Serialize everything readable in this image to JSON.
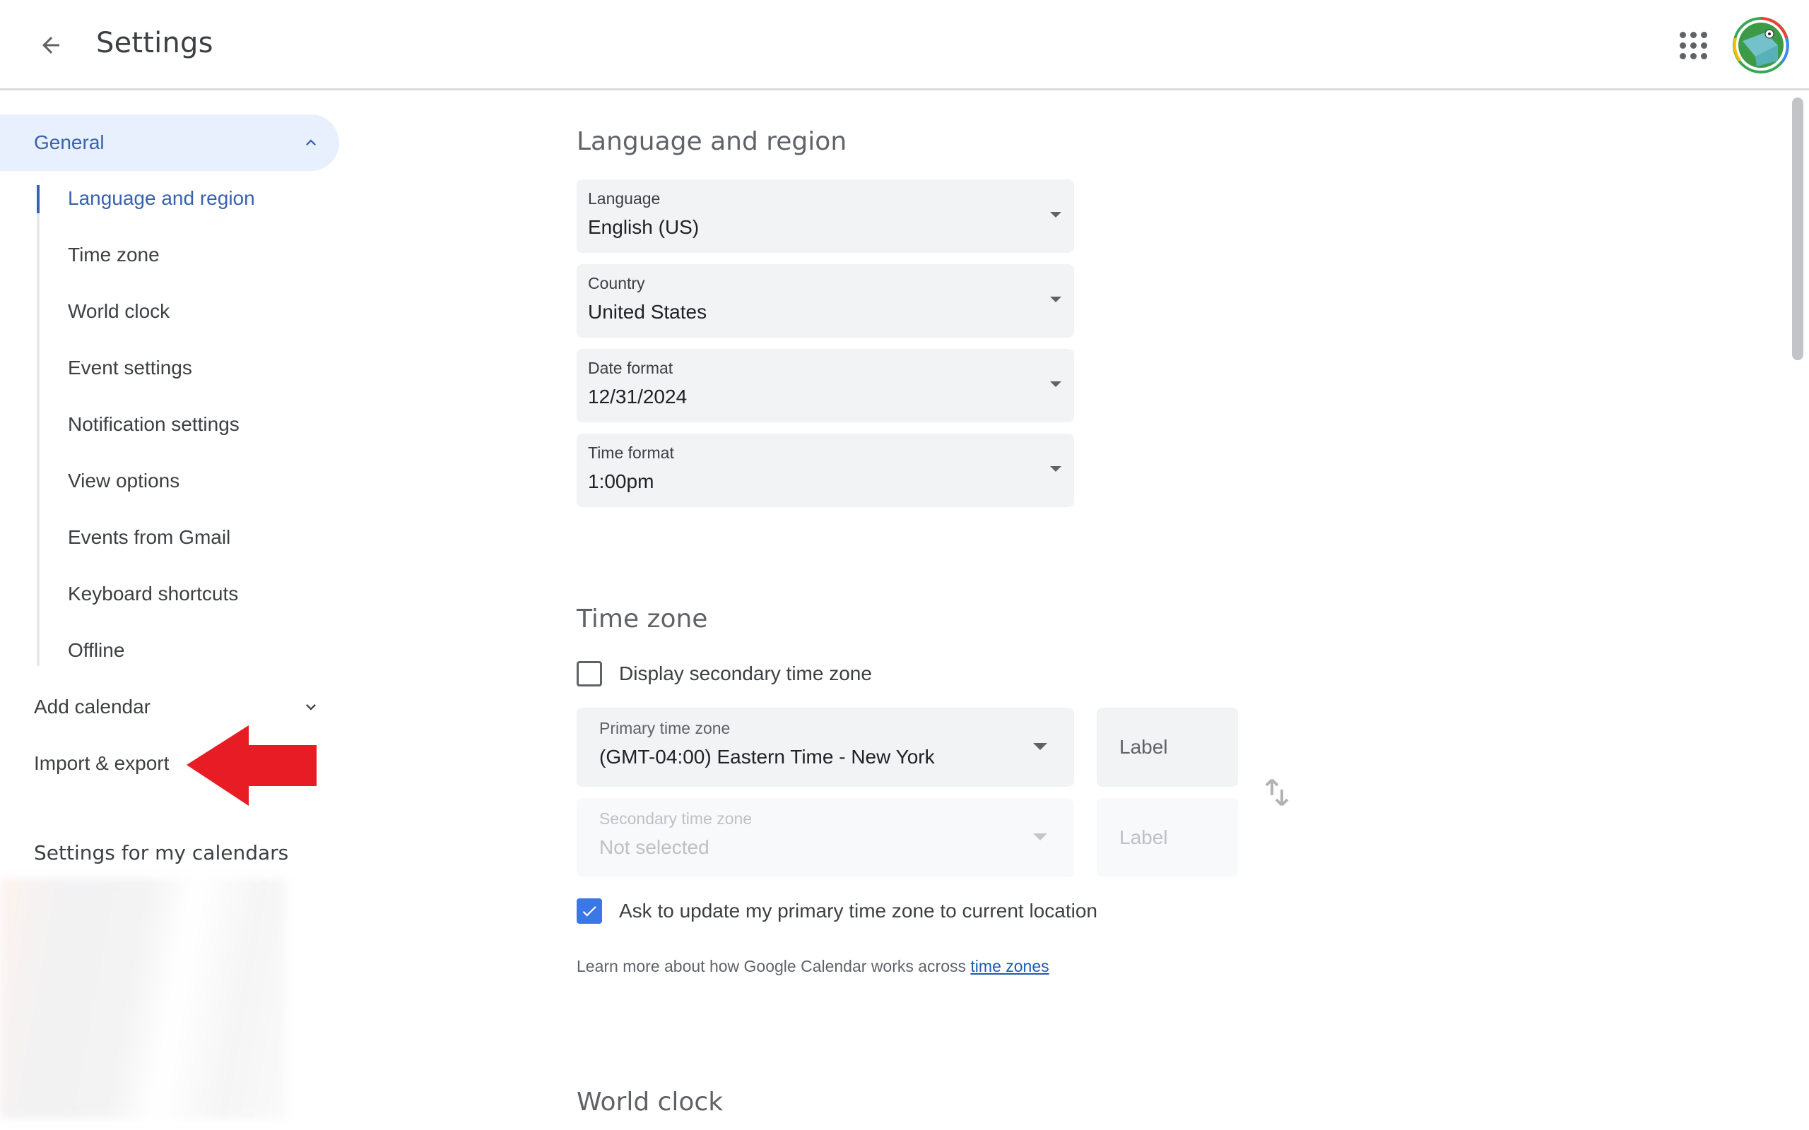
{
  "header": {
    "title": "Settings",
    "back_icon": "arrow-back-icon",
    "apps_icon": "google-apps-grid-icon",
    "avatar_alt": "account-avatar"
  },
  "sidebar": {
    "general": {
      "label": "General",
      "expanded": true,
      "items": [
        {
          "label": "Language and region",
          "active": true
        },
        {
          "label": "Time zone",
          "active": false
        },
        {
          "label": "World clock",
          "active": false
        },
        {
          "label": "Event settings",
          "active": false
        },
        {
          "label": "Notification settings",
          "active": false
        },
        {
          "label": "View options",
          "active": false
        },
        {
          "label": "Events from Gmail",
          "active": false
        },
        {
          "label": "Keyboard shortcuts",
          "active": false
        },
        {
          "label": "Offline",
          "active": false
        }
      ]
    },
    "add_calendar": {
      "label": "Add calendar",
      "expanded": false
    },
    "import_export": {
      "label": "Import & export"
    },
    "my_calendars_heading": "Settings for my calendars",
    "annotation": {
      "type": "red-arrow",
      "points_to": "Import & export",
      "color": "#e81c24"
    }
  },
  "main": {
    "language_region": {
      "title": "Language and region",
      "fields": [
        {
          "label": "Language",
          "value": "English (US)"
        },
        {
          "label": "Country",
          "value": "United States"
        },
        {
          "label": "Date format",
          "value": "12/31/2024"
        },
        {
          "label": "Time format",
          "value": "1:00pm"
        }
      ]
    },
    "time_zone": {
      "title": "Time zone",
      "display_secondary": {
        "label": "Display secondary time zone",
        "checked": false
      },
      "primary": {
        "label": "Primary time zone",
        "value": "(GMT-04:00) Eastern Time - New York",
        "label_placeholder": "Label"
      },
      "secondary": {
        "label": "Secondary time zone",
        "value": "Not selected",
        "label_placeholder": "Label",
        "disabled": true
      },
      "ask_update": {
        "label": "Ask to update my primary time zone to current location",
        "checked": true
      },
      "help_text": "Learn more about how Google Calendar works across ",
      "help_link": "time zones"
    },
    "world_clock": {
      "title": "World clock"
    }
  },
  "colors": {
    "accent": "#3762ae",
    "active_bg": "#e8f0fe",
    "checkbox_checked": "#3b78e7",
    "link": "#1a5bb5",
    "field_bg": "#f1f3f4"
  }
}
